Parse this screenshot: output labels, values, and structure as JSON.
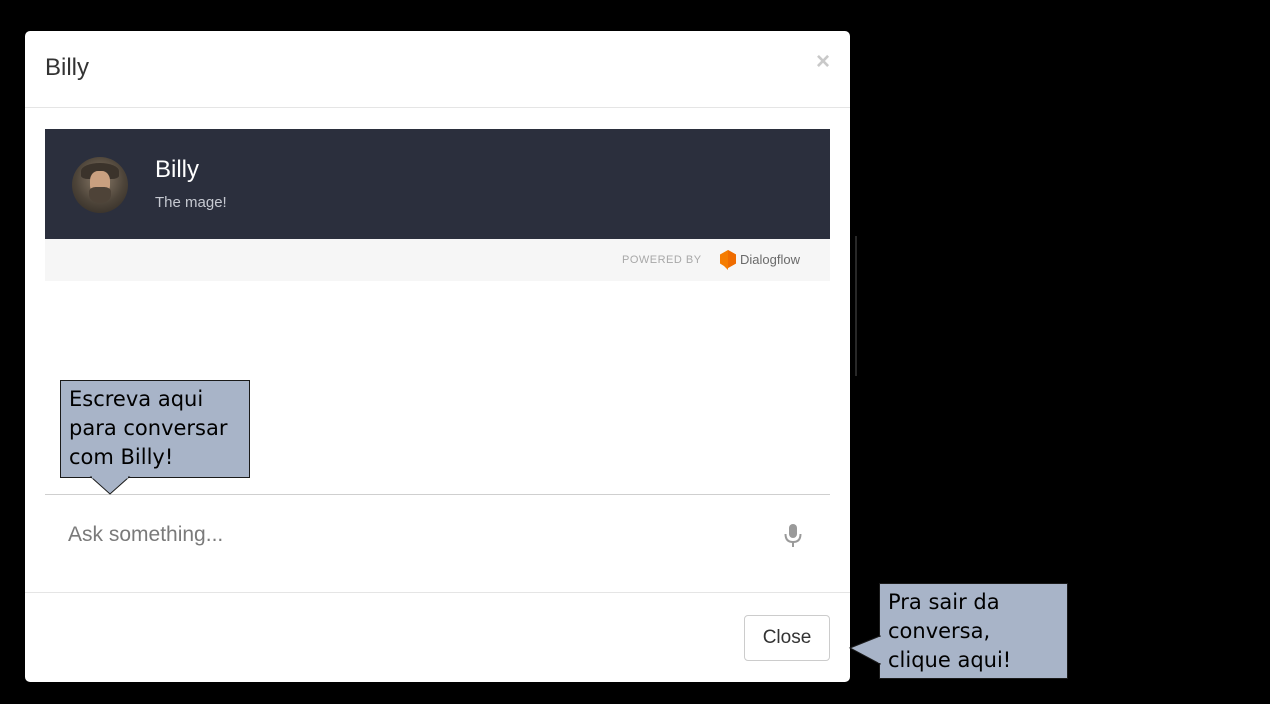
{
  "modal": {
    "title": "Billy",
    "close_symbol": "×"
  },
  "bot": {
    "name": "Billy",
    "description": "The mage!",
    "avatar_icon": "wizard-avatar"
  },
  "powered_by": {
    "label": "POWERED BY",
    "brand": "Dialogflow",
    "brand_color": "#f57c00"
  },
  "chat": {
    "placeholder": "Ask something...",
    "mic_icon": "microphone-icon"
  },
  "footer": {
    "close_label": "Close"
  },
  "callouts": {
    "chat_hint": [
      "Escreva aqui",
      "para conversar",
      "com Billy!"
    ],
    "close_hint": [
      "Pra sair da",
      "conversa,",
      "clique aqui!"
    ],
    "fill_color": "#a8b4c8"
  },
  "colors": {
    "banner": "#2b2f3d",
    "backdrop": "#000000"
  }
}
